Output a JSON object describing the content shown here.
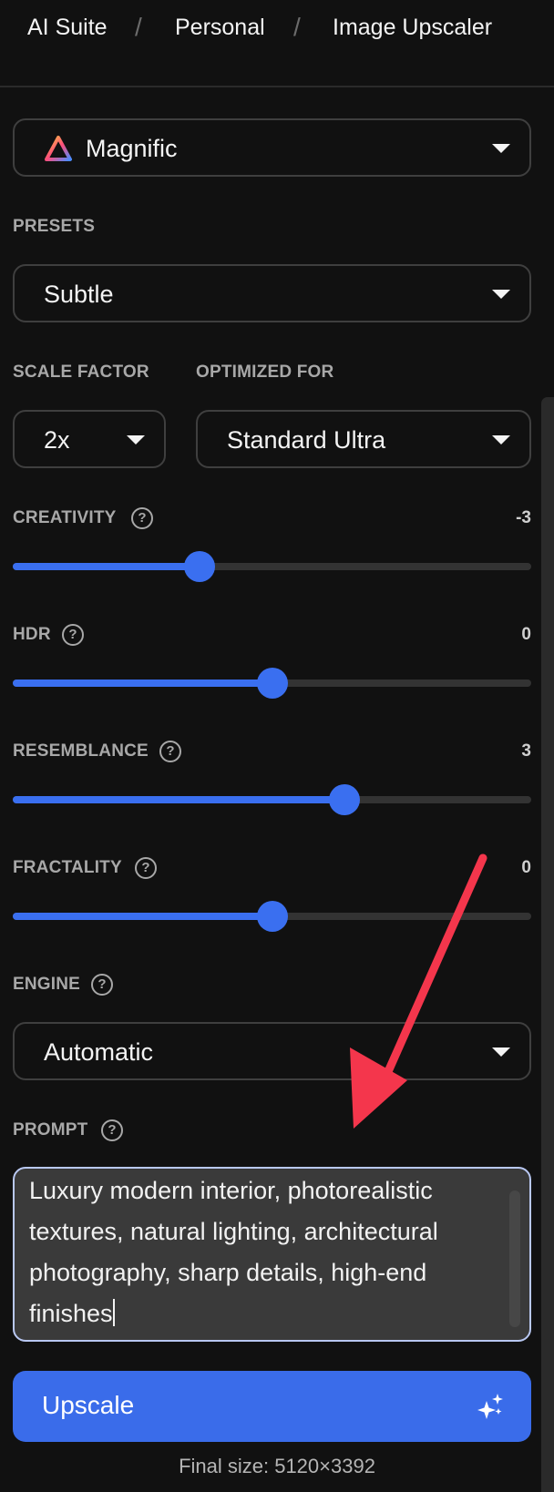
{
  "breadcrumb": {
    "items": [
      "AI Suite",
      "Personal",
      "Image Upscaler"
    ],
    "separator": "/"
  },
  "model": {
    "value": "Magnific",
    "icon": "magnific-triangle-logo"
  },
  "presets": {
    "label": "PRESETS",
    "value": "Subtle"
  },
  "scale_factor": {
    "label": "SCALE FACTOR",
    "value": "2x"
  },
  "optimized_for": {
    "label": "OPTIMIZED FOR",
    "value": "Standard Ultra"
  },
  "sliders": [
    {
      "label": "CREATIVITY",
      "value": "-3",
      "fraction": 0.36
    },
    {
      "label": "HDR",
      "value": "0",
      "fraction": 0.5
    },
    {
      "label": "RESEMBLANCE",
      "value": "3",
      "fraction": 0.64
    },
    {
      "label": "FRACTALITY",
      "value": "0",
      "fraction": 0.5
    }
  ],
  "engine": {
    "label": "ENGINE",
    "value": "Automatic"
  },
  "prompt": {
    "label": "PROMPT",
    "text": "Luxury modern interior, photorealistic textures, natural lighting, architectural photography, sharp details, high-end finishes"
  },
  "upscale_button": {
    "label": "Upscale",
    "icon": "sparkles-icon"
  },
  "final_size": "Final size: 5120×3392",
  "help_icon_glyph": "?",
  "colors": {
    "accent": "#3a6cea",
    "annotation_arrow": "#f4364c",
    "background": "#111111"
  }
}
